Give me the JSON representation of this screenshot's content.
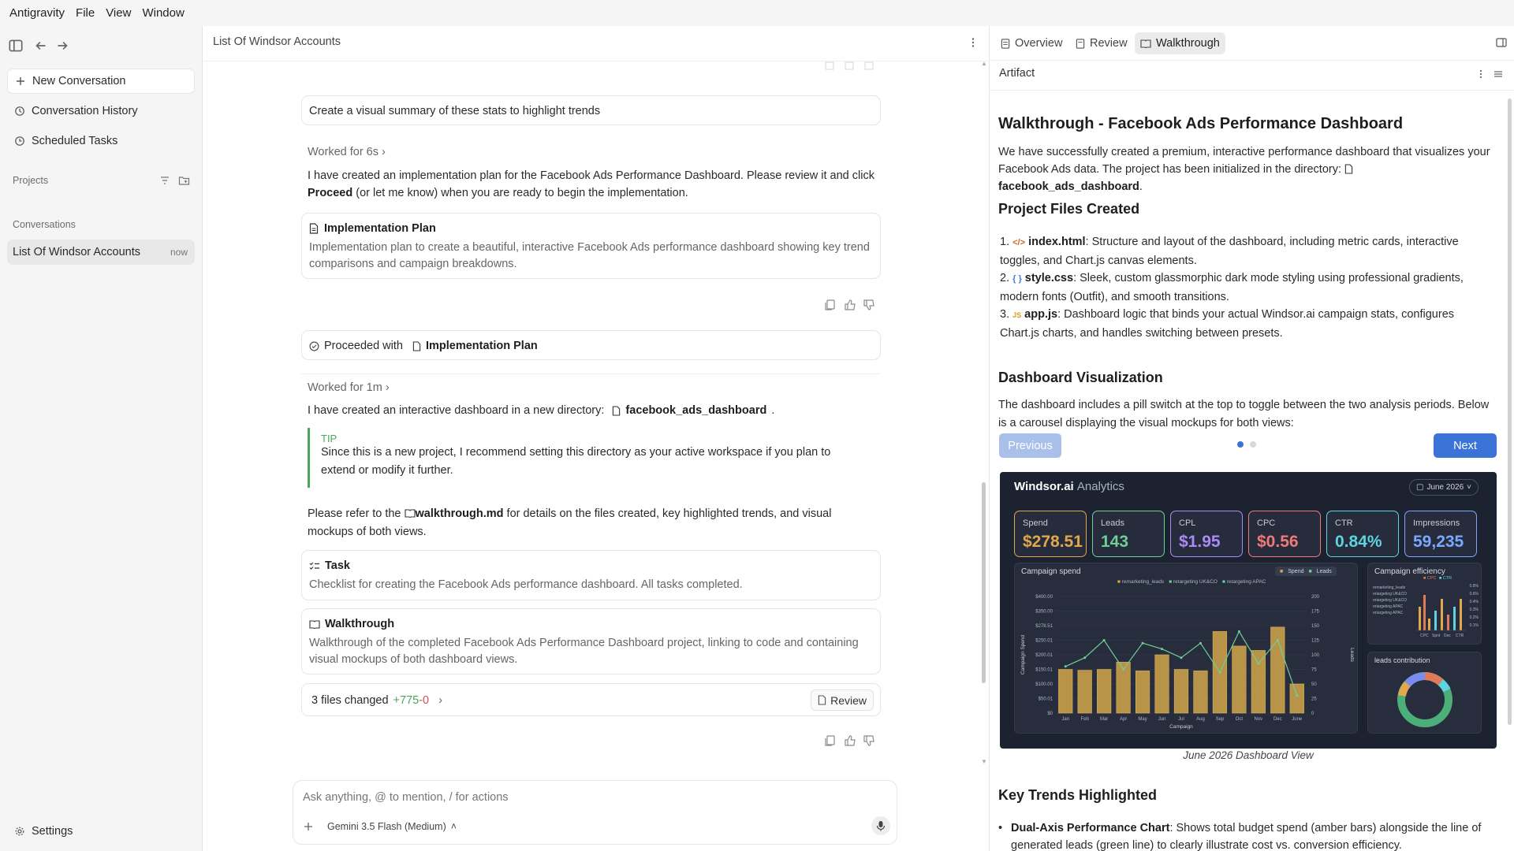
{
  "menubar": {
    "items": [
      "Antigravity",
      "File",
      "View",
      "Window"
    ]
  },
  "sidebar": {
    "new_conversation": "New Conversation",
    "conversation_history": "Conversation History",
    "scheduled_tasks": "Scheduled Tasks",
    "projects_label": "Projects",
    "conversations_label": "Conversations",
    "conversation": {
      "title": "List Of Windsor Accounts",
      "time": "now"
    },
    "settings": "Settings"
  },
  "chat": {
    "title": "List Of Windsor Accounts",
    "user_prompt": "Create a visual summary of these stats to highlight trends",
    "worked1": "Worked for 6s",
    "msg1_a": "I have created an implementation plan for the Facebook Ads Performance Dashboard. Please review it and click",
    "msg1_bold": "Proceed",
    "msg1_b": "(or let me know) when you are ready to begin the implementation.",
    "plan_card": {
      "title": "Implementation Plan",
      "desc": "Implementation plan to create a beautiful, interactive Facebook Ads performance dashboard showing key trend comparisons and campaign breakdowns."
    },
    "proceeded_label": "Proceeded with",
    "proceeded_target": "Implementation Plan",
    "worked2": "Worked for 1m",
    "msg2_a": "I have created an interactive dashboard in a new directory:",
    "msg2_dir": "facebook_ads_dashboard",
    "tip_label": "TIP",
    "tip_text": "Since this is a new project, I recommend setting this directory as your active workspace if you plan to extend or modify it further.",
    "msg3_a": "Please refer to the",
    "msg3_file": "walkthrough.md",
    "msg3_b": "for details on the files created, key highlighted trends, and visual mockups of both views.",
    "task_card": {
      "title": "Task",
      "desc": "Checklist for creating the Facebook Ads performance dashboard. All tasks completed."
    },
    "walk_card": {
      "title": "Walkthrough",
      "desc": "Walkthrough of the completed Facebook Ads Performance Dashboard project, linking to code and containing visual mockups of both dashboard views."
    },
    "files_changed": "3 files changed",
    "additions": "+775",
    "deletions": "-0",
    "review_button": "Review",
    "input_placeholder": "Ask anything, @ to mention, / for actions",
    "model": "Gemini 3.5 Flash (Medium)"
  },
  "right": {
    "tabs": [
      "Overview",
      "Review",
      "Walkthrough"
    ],
    "artifact_label": "Artifact",
    "doc_title": "Walkthrough - Facebook Ads Performance Dashboard",
    "intro_a": "We have successfully created a premium, interactive performance dashboard that visualizes your Facebook Ads data. The project has been initialized in the directory:",
    "intro_dir": "facebook_ads_dashboard",
    "h_files": "Project Files Created",
    "files": [
      {
        "num": "1.",
        "name": "index.html",
        "desc": ": Structure and layout of the dashboard, including metric cards, interactive toggles, and Chart.js canvas elements."
      },
      {
        "num": "2.",
        "name": "style.css",
        "desc": ": Sleek, custom glassmorphic dark mode styling using professional gradients, modern fonts (Outfit), and smooth transitions."
      },
      {
        "num": "3.",
        "name": "app.js",
        "desc": ": Dashboard logic that binds your actual Windsor.ai campaign stats, configures Chart.js charts, and handles switching between presets."
      }
    ],
    "h_viz": "Dashboard Visualization",
    "viz_text": "The dashboard includes a pill switch at the top to toggle between the two analysis periods. Below is a carousel displaying the visual mockups for both views:",
    "prev_button": "Previous",
    "next_button": "Next",
    "caption": "June 2026 Dashboard View",
    "h_trends": "Key Trends Highlighted",
    "trend_bold": "Dual-Axis Performance Chart",
    "trend_text": ": Shows total budget spend (amber bars) alongside the line of generated leads (green line) to clearly illustrate cost vs. conversion efficiency."
  },
  "mock": {
    "brand": "Windsor.ai",
    "brand_sub": "Analytics",
    "period": "June 2026",
    "kpis": [
      {
        "label": "Spend",
        "value": "$278.51",
        "color": "#e0a84a"
      },
      {
        "label": "Leads",
        "value": "143",
        "color": "#6fcf97"
      },
      {
        "label": "CPL",
        "value": "$1.95",
        "color": "#a98bf5"
      },
      {
        "label": "CPC",
        "value": "$0.56",
        "color": "#f07a7a"
      },
      {
        "label": "CTR",
        "value": "0.84%",
        "color": "#5fd3e0"
      },
      {
        "label": "Impressions",
        "value": "59,235",
        "color": "#7aa8ff"
      }
    ],
    "spend_title": "Campaign spend",
    "spend_legend": [
      "Spend",
      "Leads"
    ],
    "series_legend": [
      "remarketing_leads",
      "retargeting UK&CO",
      "retargeting APAC"
    ],
    "y_ticks": [
      "$400.00",
      "$350.00",
      "$278.51",
      "$250.01",
      "$200.01",
      "$150.01",
      "$100.00",
      "$50.01",
      "$0"
    ],
    "y2_ticks": [
      "200",
      "175",
      "150",
      "125",
      "100",
      "75",
      "50",
      "25",
      "0"
    ],
    "months": [
      "Jan",
      "Feb",
      "Mar",
      "Apr",
      "May",
      "Jun",
      "Jul",
      "Aug",
      "Sep",
      "Oct",
      "Nov",
      "Dec",
      "June"
    ],
    "bar_values": [
      150,
      147,
      150,
      175,
      145,
      200,
      150,
      145,
      280,
      230,
      215,
      295,
      100
    ],
    "line_values": [
      80,
      95,
      125,
      75,
      120,
      110,
      95,
      120,
      70,
      140,
      85,
      125,
      30
    ],
    "xlabel": "Campaign",
    "ylabel": "Campaign Spend",
    "y2label": "Leads",
    "eff_title": "Campaign efficiency",
    "eff_legend": [
      "CPC",
      "CTR"
    ],
    "eff_rows": [
      "remarketing_leads",
      "retargeting UK&CO",
      "retargeting UK&CO",
      "retargeting APAC",
      "retargeting APAC"
    ],
    "eff_ticks": [
      "0.8%",
      "0.6%",
      "0.4%",
      "0.3%",
      "0.2%",
      "0.1%"
    ],
    "eff_x": [
      "CPC",
      "Spnt",
      "Dec",
      "CTR"
    ],
    "leads_title": "leads contribution"
  }
}
